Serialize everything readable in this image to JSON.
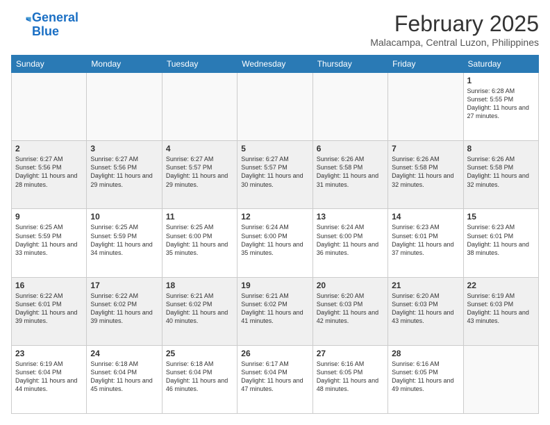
{
  "header": {
    "logo_line1": "General",
    "logo_line2": "Blue",
    "month_title": "February 2025",
    "location": "Malacampa, Central Luzon, Philippines"
  },
  "days_of_week": [
    "Sunday",
    "Monday",
    "Tuesday",
    "Wednesday",
    "Thursday",
    "Friday",
    "Saturday"
  ],
  "weeks": [
    [
      {
        "day": "",
        "info": ""
      },
      {
        "day": "",
        "info": ""
      },
      {
        "day": "",
        "info": ""
      },
      {
        "day": "",
        "info": ""
      },
      {
        "day": "",
        "info": ""
      },
      {
        "day": "",
        "info": ""
      },
      {
        "day": "1",
        "info": "Sunrise: 6:28 AM\nSunset: 5:55 PM\nDaylight: 11 hours and 27 minutes."
      }
    ],
    [
      {
        "day": "2",
        "info": "Sunrise: 6:27 AM\nSunset: 5:56 PM\nDaylight: 11 hours and 28 minutes."
      },
      {
        "day": "3",
        "info": "Sunrise: 6:27 AM\nSunset: 5:56 PM\nDaylight: 11 hours and 29 minutes."
      },
      {
        "day": "4",
        "info": "Sunrise: 6:27 AM\nSunset: 5:57 PM\nDaylight: 11 hours and 29 minutes."
      },
      {
        "day": "5",
        "info": "Sunrise: 6:27 AM\nSunset: 5:57 PM\nDaylight: 11 hours and 30 minutes."
      },
      {
        "day": "6",
        "info": "Sunrise: 6:26 AM\nSunset: 5:58 PM\nDaylight: 11 hours and 31 minutes."
      },
      {
        "day": "7",
        "info": "Sunrise: 6:26 AM\nSunset: 5:58 PM\nDaylight: 11 hours and 32 minutes."
      },
      {
        "day": "8",
        "info": "Sunrise: 6:26 AM\nSunset: 5:58 PM\nDaylight: 11 hours and 32 minutes."
      }
    ],
    [
      {
        "day": "9",
        "info": "Sunrise: 6:25 AM\nSunset: 5:59 PM\nDaylight: 11 hours and 33 minutes."
      },
      {
        "day": "10",
        "info": "Sunrise: 6:25 AM\nSunset: 5:59 PM\nDaylight: 11 hours and 34 minutes."
      },
      {
        "day": "11",
        "info": "Sunrise: 6:25 AM\nSunset: 6:00 PM\nDaylight: 11 hours and 35 minutes."
      },
      {
        "day": "12",
        "info": "Sunrise: 6:24 AM\nSunset: 6:00 PM\nDaylight: 11 hours and 35 minutes."
      },
      {
        "day": "13",
        "info": "Sunrise: 6:24 AM\nSunset: 6:00 PM\nDaylight: 11 hours and 36 minutes."
      },
      {
        "day": "14",
        "info": "Sunrise: 6:23 AM\nSunset: 6:01 PM\nDaylight: 11 hours and 37 minutes."
      },
      {
        "day": "15",
        "info": "Sunrise: 6:23 AM\nSunset: 6:01 PM\nDaylight: 11 hours and 38 minutes."
      }
    ],
    [
      {
        "day": "16",
        "info": "Sunrise: 6:22 AM\nSunset: 6:01 PM\nDaylight: 11 hours and 39 minutes."
      },
      {
        "day": "17",
        "info": "Sunrise: 6:22 AM\nSunset: 6:02 PM\nDaylight: 11 hours and 39 minutes."
      },
      {
        "day": "18",
        "info": "Sunrise: 6:21 AM\nSunset: 6:02 PM\nDaylight: 11 hours and 40 minutes."
      },
      {
        "day": "19",
        "info": "Sunrise: 6:21 AM\nSunset: 6:02 PM\nDaylight: 11 hours and 41 minutes."
      },
      {
        "day": "20",
        "info": "Sunrise: 6:20 AM\nSunset: 6:03 PM\nDaylight: 11 hours and 42 minutes."
      },
      {
        "day": "21",
        "info": "Sunrise: 6:20 AM\nSunset: 6:03 PM\nDaylight: 11 hours and 43 minutes."
      },
      {
        "day": "22",
        "info": "Sunrise: 6:19 AM\nSunset: 6:03 PM\nDaylight: 11 hours and 43 minutes."
      }
    ],
    [
      {
        "day": "23",
        "info": "Sunrise: 6:19 AM\nSunset: 6:04 PM\nDaylight: 11 hours and 44 minutes."
      },
      {
        "day": "24",
        "info": "Sunrise: 6:18 AM\nSunset: 6:04 PM\nDaylight: 11 hours and 45 minutes."
      },
      {
        "day": "25",
        "info": "Sunrise: 6:18 AM\nSunset: 6:04 PM\nDaylight: 11 hours and 46 minutes."
      },
      {
        "day": "26",
        "info": "Sunrise: 6:17 AM\nSunset: 6:04 PM\nDaylight: 11 hours and 47 minutes."
      },
      {
        "day": "27",
        "info": "Sunrise: 6:16 AM\nSunset: 6:05 PM\nDaylight: 11 hours and 48 minutes."
      },
      {
        "day": "28",
        "info": "Sunrise: 6:16 AM\nSunset: 6:05 PM\nDaylight: 11 hours and 49 minutes."
      },
      {
        "day": "",
        "info": ""
      }
    ]
  ]
}
